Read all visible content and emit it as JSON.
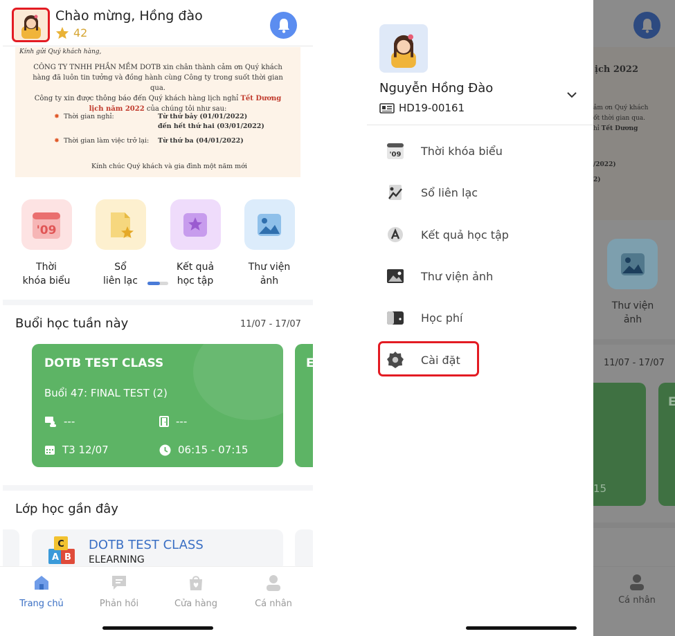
{
  "header": {
    "greeting": "Chào mừng, Hồng đào",
    "points": "42",
    "colors": {
      "accent": "#5b8df0",
      "highlight": "#e31b23",
      "star": "#e9b236"
    }
  },
  "notice": {
    "salutation": "Kính gửi Quý khách hàng,",
    "line1": "CÔNG TY TNHH PHẦN MỀM DOTB xin chân thành cảm ơn Quý khách",
    "line2": "hàng đã luôn tin tưởng và đồng hành cùng Công ty trong suốt thời gian qua.",
    "line3": "Công ty xin được thông báo đến Quý khách hàng lịch nghỉ",
    "line3_bold": "Tết Dương",
    "line4_bold": "lịch năm 2022",
    "line4": "của chúng tôi như sau:",
    "off_label": "Thời gian nghỉ:",
    "off_from": "Từ thứ bảy (01/01/2022)",
    "off_to": "đến hết thứ hai (03/01/2022)",
    "back_label": "Thời gian làm việc trở lại:",
    "back_value": "Từ thứ ba (04/01/2022)",
    "wish": "Kính chúc Quý khách và gia đình một năm mới"
  },
  "features": [
    {
      "label": "Thời\nkhóa biểu",
      "icon": "calendar-09-icon",
      "bg": "#fde3e3"
    },
    {
      "label": "Sổ\nliên lạc",
      "icon": "notebook-star-icon",
      "bg": "#fdf0cf"
    },
    {
      "label": "Kết quả\nhọc tập",
      "icon": "star-square-icon",
      "bg": "#efdcfb"
    },
    {
      "label": "Thư viện\nảnh",
      "icon": "image-gallery-icon",
      "bg": "#dcecfb"
    }
  ],
  "week": {
    "title": "Buổi học tuần này",
    "range": "11/07 - 17/07",
    "card": {
      "name": "DOTB TEST CLASS",
      "session": "Buổi 47: FINAL TEST (2)",
      "teacher": "---",
      "room": "---",
      "date": "T3 12/07",
      "time": "06:15 - 07:15",
      "color": "#5db465"
    },
    "next_card_initial": "E"
  },
  "recent": {
    "title": "Lớp học gần đây",
    "card": {
      "name": "DOTB TEST CLASS",
      "type": "ELEARNING"
    }
  },
  "nav": [
    {
      "label": "Trang chủ",
      "icon": "home-icon",
      "active": true
    },
    {
      "label": "Phản hồi",
      "icon": "chat-icon",
      "active": false
    },
    {
      "label": "Cửa hàng",
      "icon": "shop-bag-icon",
      "active": false
    },
    {
      "label": "Cá nhân",
      "icon": "person-icon",
      "active": false
    }
  ],
  "drawer": {
    "name": "Nguyễn Hồng Đào",
    "student_id": "HD19-00161",
    "menu": [
      {
        "label": "Thời khóa biểu",
        "icon": "calendar-09-icon"
      },
      {
        "label": "Sổ liên lạc",
        "icon": "chart-book-icon"
      },
      {
        "label": "Kết quả học tập",
        "icon": "medal-icon"
      },
      {
        "label": "Thư viện ảnh",
        "icon": "image-icon"
      },
      {
        "label": "Học phí",
        "icon": "wallet-icon"
      },
      {
        "label": "Cài đặt",
        "icon": "gear-icon"
      }
    ]
  },
  "background": {
    "notice_title_fragment": "ịch 2022",
    "notice_fragment_1": "ảm ơn Quý khách",
    "notice_fragment_2": "ốt thời gian qua.",
    "notice_fragment_3": "hỉ",
    "notice_fragment_3_bold": "Tết Dương",
    "notice_fragment_4": "/2022)",
    "notice_fragment_5": "2)",
    "tile_label": "Thư viện\nảnh",
    "week_range": "11/07 - 17/07",
    "card_time_fragment": "15",
    "card_initial": "E",
    "nav_label": "Cá nhân"
  }
}
